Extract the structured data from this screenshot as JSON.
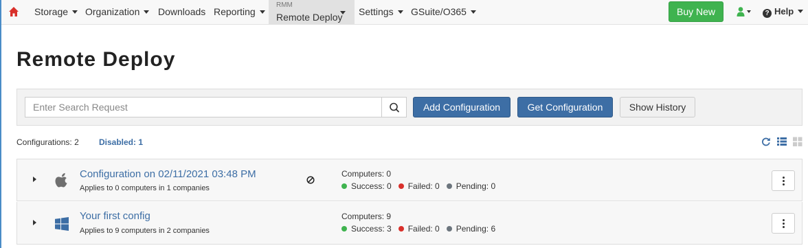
{
  "nav": {
    "items": [
      {
        "label": "Storage",
        "has_caret": true
      },
      {
        "label": "Organization",
        "has_caret": true
      },
      {
        "label": "Downloads",
        "has_caret": false
      },
      {
        "label": "Reporting",
        "has_caret": true
      },
      {
        "label": "Settings",
        "has_caret": true
      },
      {
        "label": "GSuite/O365",
        "has_caret": true
      }
    ],
    "active": {
      "sublabel": "RMM",
      "label": "Remote Deploy"
    },
    "buy_label": "Buy New",
    "help_label": "Help",
    "home_icon": "home-icon",
    "home_color": "#d9302b"
  },
  "page": {
    "title": "Remote Deploy"
  },
  "search": {
    "placeholder": "Enter Search Request",
    "add_label": "Add Configuration",
    "get_label": "Get Configuration",
    "history_label": "Show History"
  },
  "stats": {
    "configurations_label": "Configurations:",
    "configurations_count": "2",
    "disabled_label": "Disabled:",
    "disabled_count": "1"
  },
  "configs": [
    {
      "name": "Configuration on 02/11/2021 03:48 PM",
      "applies": "Applies to 0 computers in 1 companies",
      "os_icon": "apple-icon",
      "disabled": true,
      "computers_label": "Computers: 0",
      "success": "Success: 0",
      "failed": "Failed: 0",
      "pending": "Pending: 0"
    },
    {
      "name": "Your first config",
      "applies": "Applies to 9 computers in 2 companies",
      "os_icon": "windows-icon",
      "disabled": false,
      "computers_label": "Computers: 9",
      "success": "Success: 3",
      "failed": "Failed: 0",
      "pending": "Pending: 6"
    }
  ],
  "colors": {
    "primary": "#3d6ea5",
    "buy": "#3fb34f",
    "success": "#3fb34f",
    "failed": "#d9302b",
    "pending": "#6c757d"
  }
}
